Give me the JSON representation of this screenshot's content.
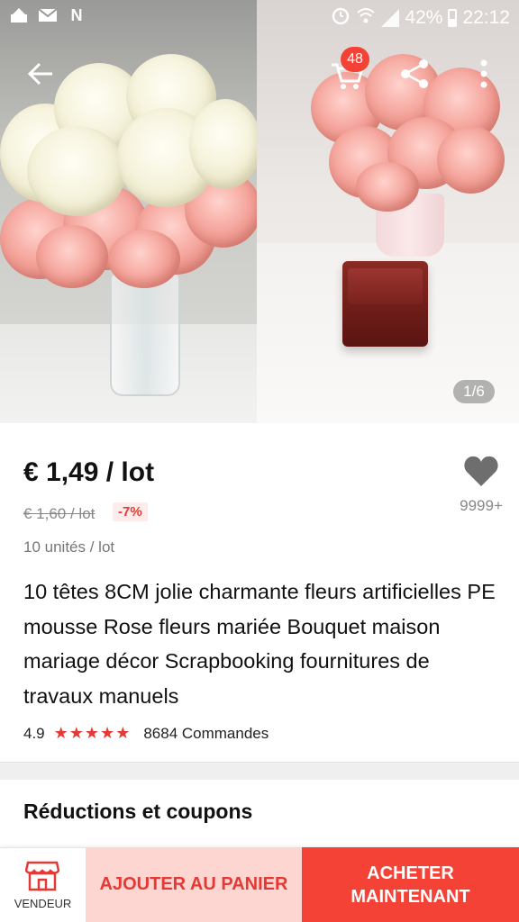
{
  "status_bar": {
    "battery_percent": "42%",
    "time": "22:12",
    "notification_icons": [
      "gallery-icon",
      "mail-icon",
      "netflix-icon"
    ],
    "system_icons": [
      "alarm-icon",
      "wifi-icon",
      "signal-icon",
      "battery-icon"
    ]
  },
  "top_nav": {
    "cart_count": "48"
  },
  "gallery": {
    "counter": "1/6"
  },
  "product": {
    "price": "€ 1,49 / lot",
    "old_price": "€ 1,60 / lot",
    "discount": "-7%",
    "units": "10 unités / lot",
    "wishlist_count": "9999+",
    "title": "10 têtes 8CM jolie charmante fleurs artificielles PE mousse Rose fleurs mariée Bouquet maison mariage décor Scrapbooking fournitures de travaux manuels",
    "rating": "4.9",
    "stars": "★★★★★",
    "orders": "8684 Commandes"
  },
  "sections": {
    "coupons_title": "Réductions et coupons"
  },
  "bottom_bar": {
    "vendor_label": "VENDEUR",
    "add_to_cart_label": "AJOUTER AU PANIER",
    "buy_now_label": "ACHETER MAINTENANT"
  },
  "colors": {
    "accent_red": "#f44336",
    "light_red": "#fdd6d1",
    "star_red": "#e53935"
  }
}
